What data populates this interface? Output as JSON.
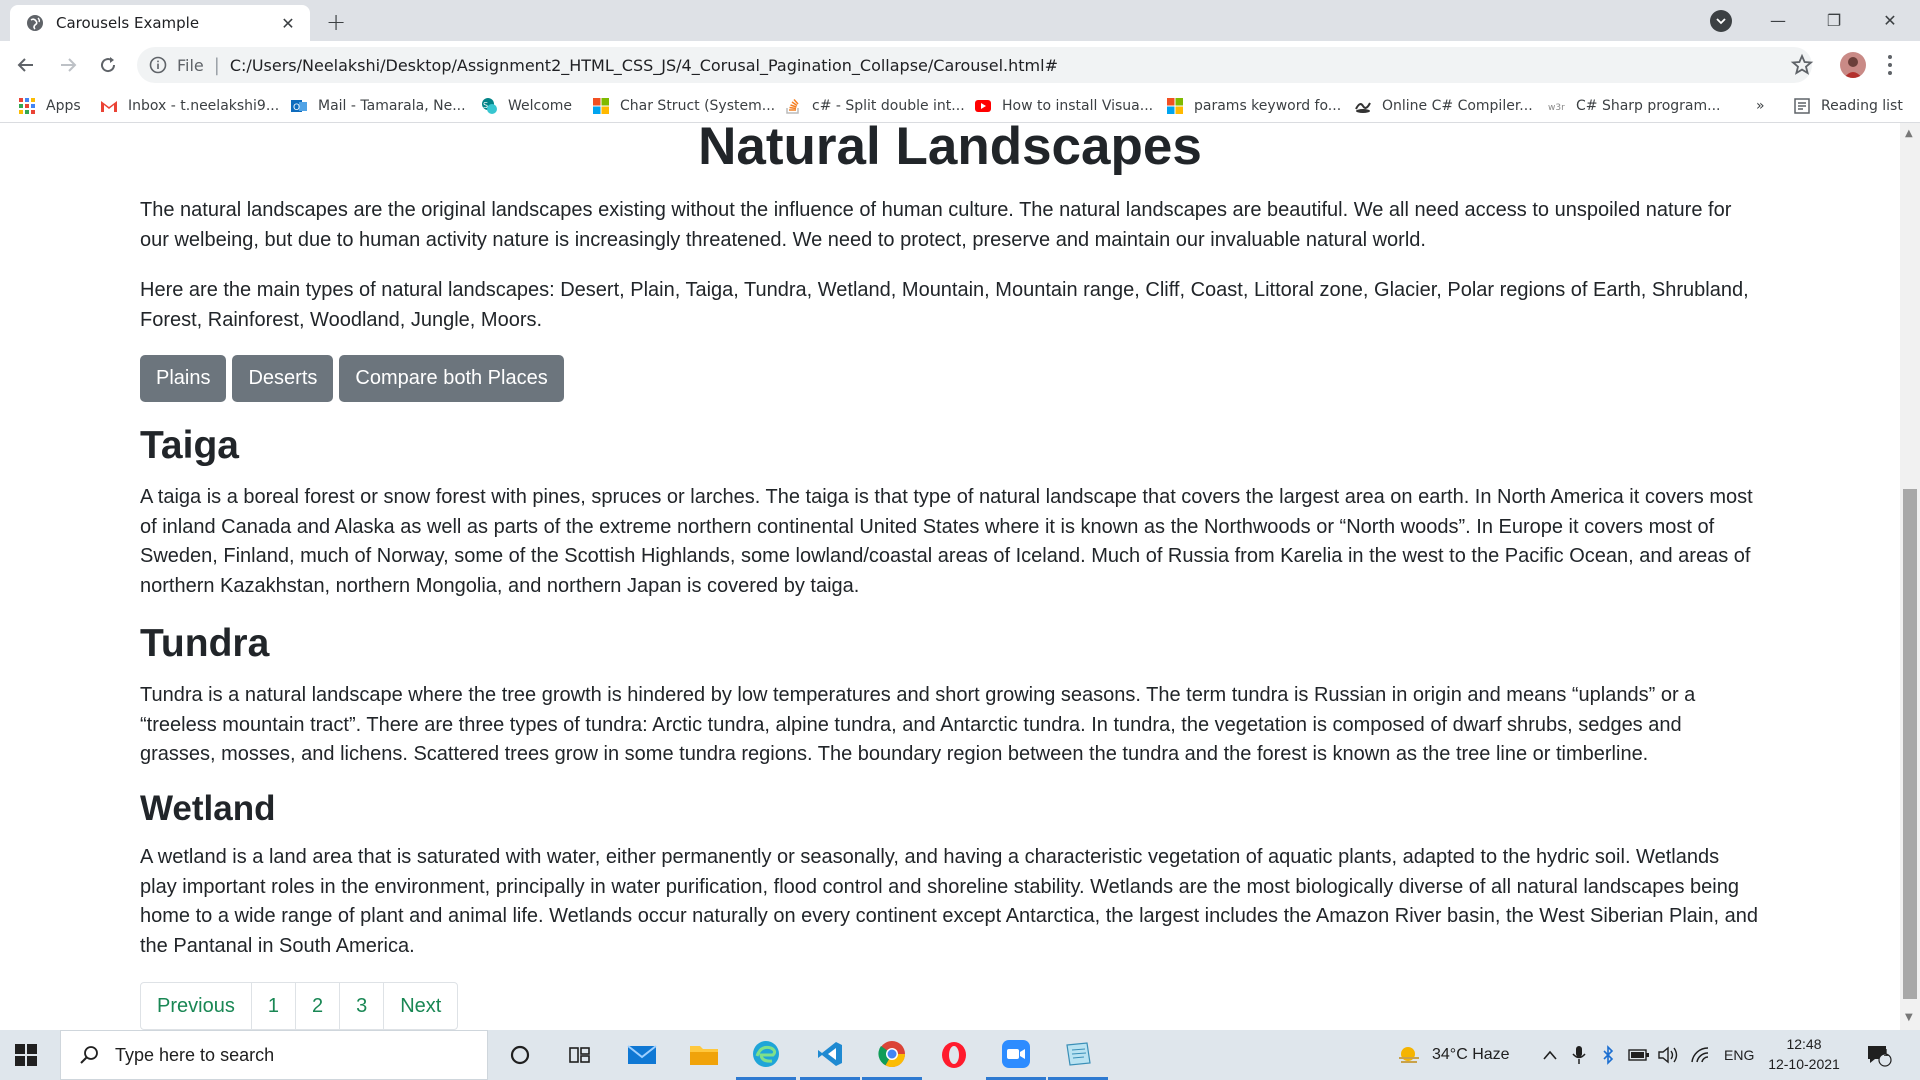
{
  "browser": {
    "tab_title": "Carousels Example",
    "tab_close": "✕",
    "new_tab": "+",
    "scheme_label": "File",
    "separator": "|",
    "url": "C:/Users/Neelakshi/Desktop/Assignment2_HTML_CSS_JS/4_Corusal_Pagination_Collapse/Carousel.html#",
    "minimize": "—",
    "restore": "❐",
    "close": "✕"
  },
  "bookmarks": {
    "items": [
      {
        "label": "Apps",
        "icon": "apps-grid-icon"
      },
      {
        "label": "Inbox - t.neelakshi9...",
        "icon": "gmail-icon"
      },
      {
        "label": "Mail - Tamarala, Ne...",
        "icon": "outlook-icon"
      },
      {
        "label": "Welcome",
        "icon": "sharepoint-icon"
      },
      {
        "label": "Char Struct (System...",
        "icon": "microsoft-icon"
      },
      {
        "label": "c# - Split double int...",
        "icon": "stackoverflow-icon"
      },
      {
        "label": "How to install Visua...",
        "icon": "youtube-icon"
      },
      {
        "label": "params keyword fo...",
        "icon": "microsoft-icon"
      },
      {
        "label": "Online C# Compiler...",
        "icon": "compiler-icon"
      },
      {
        "label": "C# Sharp program...",
        "icon": "w3resource-icon"
      }
    ],
    "overflow": "»",
    "reading_list": "Reading list"
  },
  "page": {
    "heading": "Natural Landscapes",
    "intro1": "The natural landscapes are the original landscapes existing without the influence of human culture. The natural landscapes are beautiful. We all need access to unspoiled nature for our welbeing, but due to human activity nature is increasingly threatened. We need to protect, preserve and maintain our invaluable natural world.",
    "intro2": "Here are the main types of natural landscapes: Desert, Plain, Taiga, Tundra, Wetland, Mountain, Mountain range, Cliff, Coast, Littoral zone, Glacier, Polar regions of Earth, Shrubland, Forest, Rainforest, Woodland, Jungle, Moors.",
    "buttons": [
      "Plains",
      "Deserts",
      "Compare both Places"
    ],
    "sections": [
      {
        "title": "Taiga",
        "text": "A taiga is a boreal forest or snow forest with pines, spruces or larches. The taiga is that type of natural landscape that covers the largest area on earth. In North America it covers most of inland Canada and Alaska as well as parts of the extreme northern continental United States where it is known as the Northwoods or “North woods”. In Europe it covers most of Sweden, Finland, much of Norway, some of the Scottish Highlands, some lowland/coastal areas of Iceland. Much of Russia from Karelia in the west to the Pacific Ocean, and areas of northern Kazakhstan, northern Mongolia, and northern Japan is covered by taiga."
      },
      {
        "title": "Tundra",
        "text": "Tundra is a natural landscape where the tree growth is hindered by low temperatures and short growing seasons. The term tundra is Russian in origin and means “uplands” or a “treeless mountain tract”. There are three types of tundra: Arctic tundra, alpine tundra, and Antarctic tundra. In tundra, the vegetation is composed of dwarf shrubs, sedges and grasses, mosses, and lichens. Scattered trees grow in some tundra regions. The boundary region between the tundra and the forest is known as the tree line or timberline."
      },
      {
        "title": "Wetland",
        "text": "A wetland is a land area that is saturated with water, either permanently or seasonally, and having a characteristic vegetation of aquatic plants, adapted to the hydric soil. Wetlands play important roles in the environment, principally in water purification, flood control and shoreline stability. Wetlands are the most biologically diverse of all natural landscapes being home to a wide range of plant and animal life. Wetlands occur naturally on every continent except Antarctica, the largest includes the Amazon River basin, the West Siberian Plain, and the Pantanal in South America."
      }
    ],
    "pagination": [
      "Previous",
      "1",
      "2",
      "3",
      "Next"
    ]
  },
  "taskbar": {
    "search_placeholder": "Type here to search",
    "weather": "34°C  Haze",
    "language": "ENG",
    "time": "12:48",
    "date": "12-10-2021",
    "notification_count": "1"
  },
  "colors": {
    "button_bg": "#6c757d",
    "pagination_link": "#198754",
    "text": "#212529"
  }
}
